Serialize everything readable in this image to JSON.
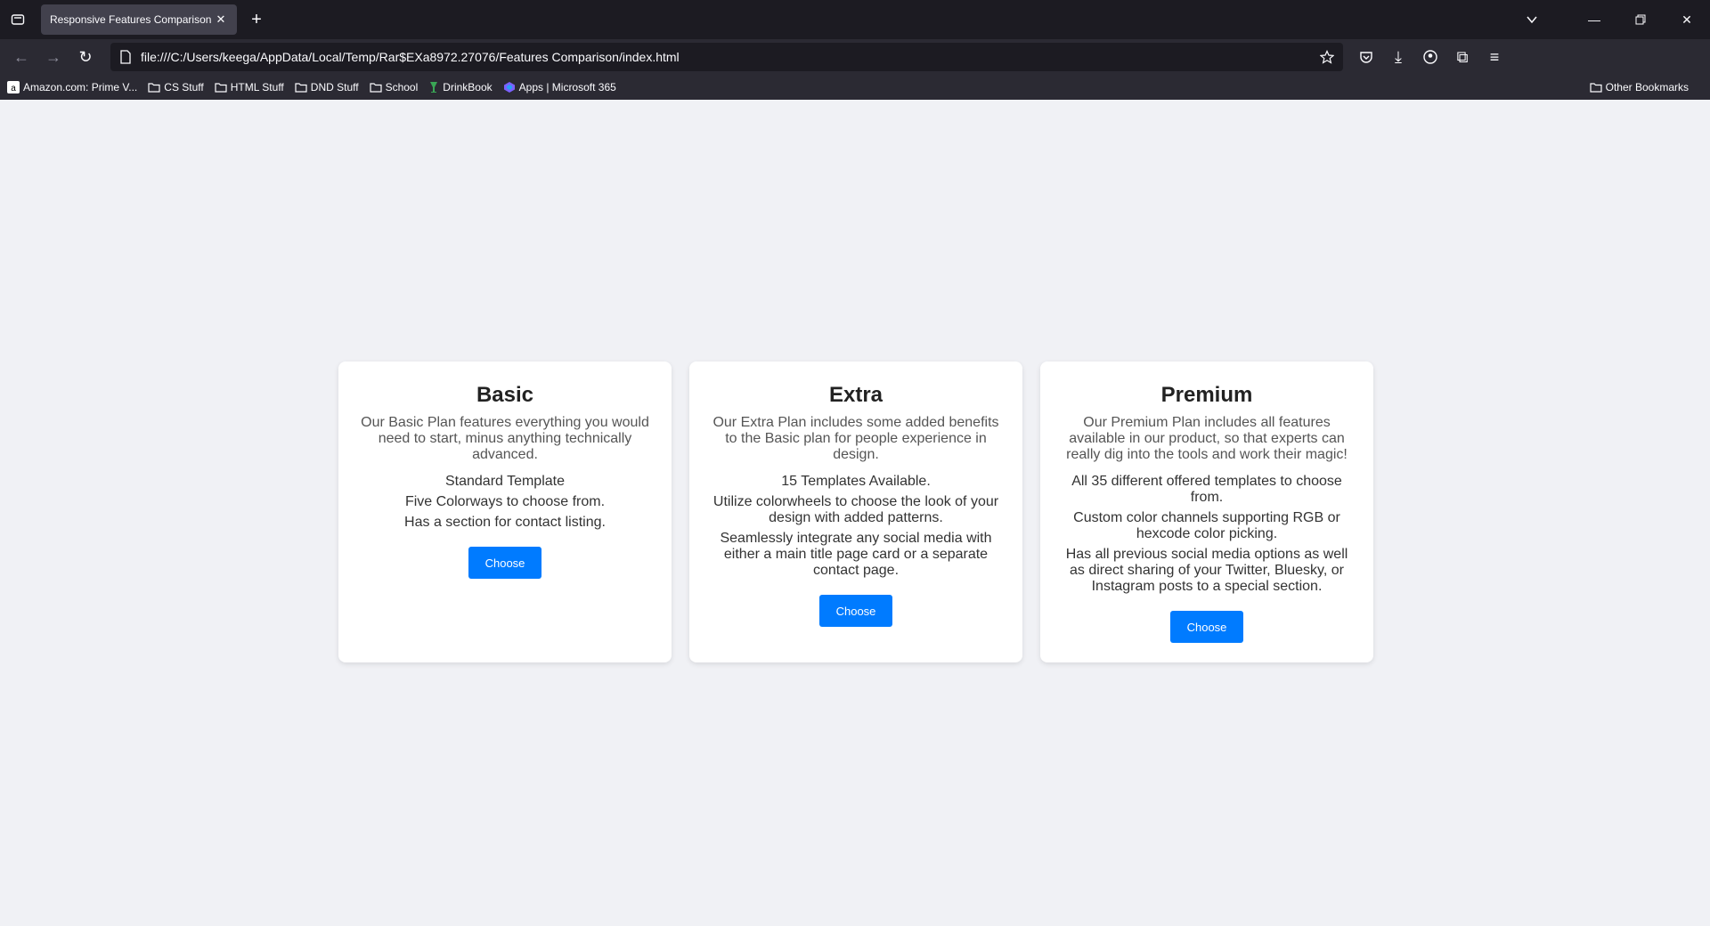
{
  "browser": {
    "tab_title": "Responsive Features Comparison T",
    "url": "file:///C:/Users/keega/AppData/Local/Temp/Rar$EXa8972.27076/Features Comparison/index.html",
    "bookmarks": [
      {
        "label": "Amazon.com: Prime V...",
        "icon": "amazon-icon"
      },
      {
        "label": "CS Stuff",
        "icon": "folder-icon"
      },
      {
        "label": "HTML Stuff",
        "icon": "folder-icon"
      },
      {
        "label": "DND Stuff",
        "icon": "folder-icon"
      },
      {
        "label": "School",
        "icon": "folder-icon"
      },
      {
        "label": "DrinkBook",
        "icon": "drinkbook-icon"
      },
      {
        "label": "Apps | Microsoft 365",
        "icon": "microsoft-365-icon"
      }
    ],
    "other_bookmarks": "Other Bookmarks"
  },
  "plans": [
    {
      "title": "Basic",
      "description": "Our Basic Plan features everything you would need to start, minus anything technically advanced.",
      "features": [
        "Standard Template",
        "Five Colorways to choose from.",
        "Has a section for contact listing."
      ],
      "button": "Choose"
    },
    {
      "title": "Extra",
      "description": "Our Extra Plan includes some added benefits to the Basic plan for people experience in design.",
      "features": [
        "15 Templates Available.",
        "Utilize colorwheels to choose the look of your design with added patterns.",
        "Seamlessly integrate any social media with either a main title page card or a separate contact page."
      ],
      "button": "Choose"
    },
    {
      "title": "Premium",
      "description": "Our Premium Plan includes all features available in our product, so that experts can really dig into the tools and work their magic!",
      "features": [
        "All 35 different offered templates to choose from.",
        "Custom color channels supporting RGB or hexcode color picking.",
        "Has all previous social media options as well as direct sharing of your Twitter, Bluesky, or Instagram posts to a special section."
      ],
      "button": "Choose"
    }
  ],
  "colors": {
    "button": "#007bff",
    "page_bg": "#f0f1f5",
    "chrome_bg": "#1c1b22"
  }
}
